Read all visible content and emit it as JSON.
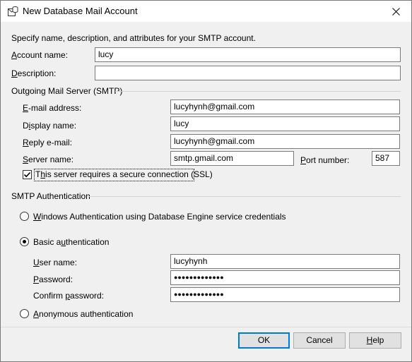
{
  "window": {
    "title": "New Database Mail Account",
    "icon": "database-mail-icon",
    "close_icon": "close-icon"
  },
  "intro": "Specify name, description, and attributes for your SMTP account.",
  "account": {
    "name_label_u": "A",
    "name_label_rest": "ccount name:",
    "name_value": "lucy",
    "desc_label_u": "D",
    "desc_label_rest": "escription:",
    "desc_value": ""
  },
  "smtp": {
    "group_label": "Outgoing Mail Server (SMTP)",
    "email_label_u": "E",
    "email_label_rest": "-mail address:",
    "email_value": "lucyhynh@gmail.com",
    "display_label_pre": "D",
    "display_label_u": "i",
    "display_label_rest": "splay name:",
    "display_value": "lucy",
    "reply_label_u": "R",
    "reply_label_rest": "eply e-mail:",
    "reply_value": "lucyhynh@gmail.com",
    "server_label_u": "S",
    "server_label_rest": "erver name:",
    "server_value": "smtp.gmail.com",
    "port_label_u": "P",
    "port_label_rest": "ort number:",
    "port_value": "587",
    "ssl_label_pre": "T",
    "ssl_label_u": "h",
    "ssl_label_rest": "is server requires a secure connection (SSL)",
    "ssl_checked": true
  },
  "auth": {
    "group_label": "SMTP Authentication",
    "windows_label_u": "W",
    "windows_label_rest": "indows Authentication using Database Engine service credentials",
    "basic_label_pre": "Basic a",
    "basic_label_u": "u",
    "basic_label_rest": "thentication",
    "selected": "basic",
    "user_label_u": "U",
    "user_label_rest": "ser name:",
    "user_value": "lucyhynh",
    "password_label_u": "P",
    "password_label_rest": "assword:",
    "password_value": "●●●●●●●●●●●●●",
    "confirm_label_pre": "Confirm ",
    "confirm_label_u": "p",
    "confirm_label_rest": "assword:",
    "confirm_value": "●●●●●●●●●●●●●",
    "anon_label_u": "A",
    "anon_label_rest": "nonymous authentication"
  },
  "buttons": {
    "ok": "OK",
    "cancel": "Cancel",
    "help_u": "H",
    "help_rest": "elp"
  }
}
